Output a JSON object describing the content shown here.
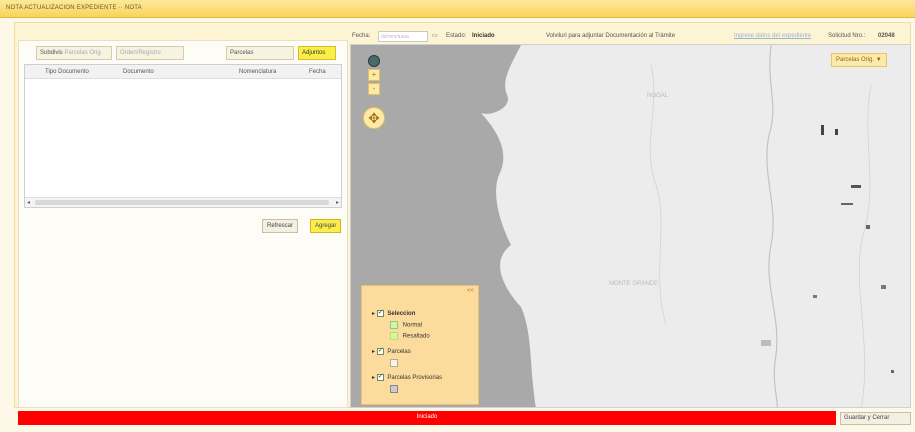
{
  "window": {
    "title": "NOTA ACTUALIZACION EXPEDIENTE ·· NOTA"
  },
  "left": {
    "tabs": [
      {
        "label": "Subdivis",
        "placeholder": "Parcelas Orig"
      },
      {
        "label": "",
        "placeholder": "Orden/Registro"
      },
      {
        "label": "Parcelas",
        "placeholder": ""
      },
      {
        "label": "Adjuntos",
        "placeholder": ""
      }
    ],
    "columns": [
      "Tipo Documento",
      "Documento",
      "Nomenclatura",
      "Fecha"
    ],
    "refresh_label": "Refrescar",
    "add_label": "Agregar"
  },
  "topbar": {
    "fecha_label": "Fecha:",
    "fecha_placeholder": "dd/mm/aaaa",
    "estado_label": "Estado:",
    "estado_value": "Iniciado",
    "notice": "Volviluri para adjuntar Documentación al Trámite",
    "link": "Ingrese datos del expediente",
    "solicitud_label": "Solicitud Nro.:",
    "solicitud_value": "02048"
  },
  "map": {
    "layer_dropdown": "Parcelas Orig.",
    "zoom_in": "+",
    "zoom_out": "-",
    "pan": "✥",
    "map_labels": [
      "NOGAL",
      "MONTE GRANDE"
    ],
    "legend": {
      "collapse": "<<",
      "groups": [
        {
          "label": "Seleccion",
          "items": [
            "Normal",
            "Resaltado"
          ]
        },
        {
          "label": "Parcelas",
          "items": [
            ""
          ]
        },
        {
          "label": "Parcelas Provisorias",
          "items": [
            ""
          ]
        }
      ]
    },
    "colors": {
      "water": "#a9a9a9",
      "land": "#ececec",
      "river": "#c3c3c3"
    }
  },
  "status": {
    "text": "Iniciado",
    "color": "#ff0000"
  },
  "close_label": "Guardar y Cerrar"
}
